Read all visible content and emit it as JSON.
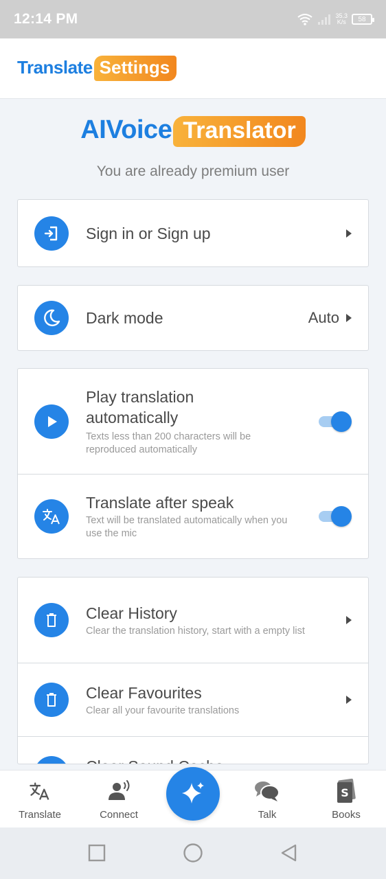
{
  "status_bar": {
    "time": "12:14 PM",
    "speed_value": "35.3",
    "speed_unit": "K/s",
    "battery": "58"
  },
  "header": {
    "title_part1": "Translate",
    "title_part2": "Settings"
  },
  "brand": {
    "part1": "AIVoice",
    "part2": "Translator"
  },
  "premium_text": "You are already premium user",
  "items": {
    "signin": {
      "title": "Sign in or Sign up",
      "icon": "login-icon"
    },
    "dark_mode": {
      "title": "Dark mode",
      "value": "Auto",
      "icon": "moon-icon"
    },
    "play_translation": {
      "title": "Play translation automatically",
      "subtitle": "Texts less than 200 characters will be reproduced automatically",
      "enabled": true,
      "icon": "play-icon"
    },
    "translate_after_speak": {
      "title": "Translate after speak",
      "subtitle": "Text will be translated automatically when you use the mic",
      "enabled": true,
      "icon": "translate-icon"
    },
    "clear_history": {
      "title": "Clear History",
      "subtitle": "Clear the translation history, start with a empty list",
      "icon": "trash-icon"
    },
    "clear_favourites": {
      "title": "Clear Favourites",
      "subtitle": "Clear all your favourite translations",
      "icon": "trash-icon"
    },
    "clear_sound_cache": {
      "title": "Clear Sound Cache",
      "icon": "trash-icon"
    }
  },
  "bottom_nav": [
    {
      "label": "Translate",
      "icon": "translate-icon"
    },
    {
      "label": "Connect",
      "icon": "person-voice-icon"
    },
    {
      "label": "",
      "icon": "sparkle-icon"
    },
    {
      "label": "Talk",
      "icon": "chat-bubbles-icon"
    },
    {
      "label": "Books",
      "icon": "book-icon"
    }
  ],
  "colors": {
    "accent": "#2584e6",
    "brand_blue": "#1d7fe0",
    "brand_orange": "#f2871e",
    "background": "#f1f4f8"
  }
}
